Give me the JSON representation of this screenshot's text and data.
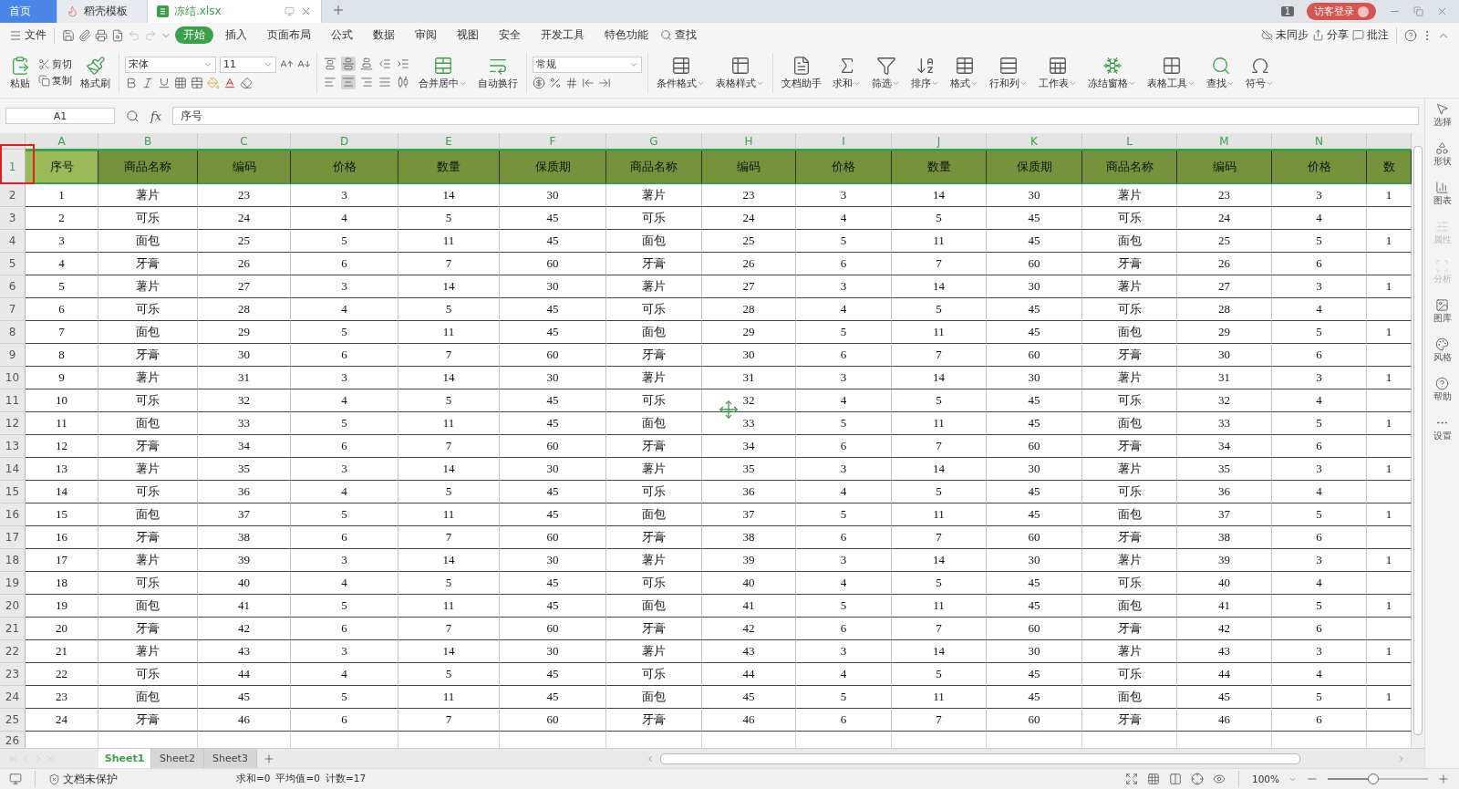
{
  "app_tabs": [
    {
      "label": "首页",
      "kind": "home",
      "selected": false
    },
    {
      "label": "稻壳模板",
      "kind": "template",
      "selected": false
    },
    {
      "label": "冻结.xlsx",
      "kind": "sheet",
      "selected": true
    }
  ],
  "top_right": {
    "badge": "1",
    "login": "访客登录"
  },
  "menu": {
    "file": "文件",
    "tabs": [
      {
        "label": "开始",
        "selected": true
      },
      {
        "label": "插入",
        "selected": false
      },
      {
        "label": "页面布局",
        "selected": false
      },
      {
        "label": "公式",
        "selected": false
      },
      {
        "label": "数据",
        "selected": false
      },
      {
        "label": "审阅",
        "selected": false
      },
      {
        "label": "视图",
        "selected": false
      },
      {
        "label": "安全",
        "selected": false
      },
      {
        "label": "开发工具",
        "selected": false
      },
      {
        "label": "特色功能",
        "selected": false
      }
    ],
    "search": "查找",
    "actions": [
      {
        "label": "未同步",
        "kind": "sync"
      },
      {
        "label": "分享",
        "kind": "share"
      },
      {
        "label": "批注",
        "kind": "comment"
      }
    ]
  },
  "ribbon": {
    "paste": "粘贴",
    "cut": "剪切",
    "copy": "复制",
    "format_painter": "格式刷",
    "font_name": "宋体",
    "font_size": "11",
    "align": [
      {
        "kind": "top",
        "selected": false
      },
      {
        "kind": "middle",
        "selected": true
      },
      {
        "kind": "bottom",
        "selected": false
      },
      {
        "kind": "outdent",
        "selected": false
      },
      {
        "kind": "indent",
        "selected": false
      },
      {
        "kind": "left",
        "selected": false
      },
      {
        "kind": "center",
        "selected": true
      },
      {
        "kind": "right",
        "selected": false
      },
      {
        "kind": "justify",
        "selected": false
      },
      {
        "kind": "distribute",
        "selected": false
      }
    ],
    "merge": "合并居中",
    "wrap": "自动换行",
    "number_format": "常规",
    "buttons": [
      {
        "label": "条件格式",
        "kind": "conditional"
      },
      {
        "label": "表格样式",
        "kind": "style"
      },
      {
        "label": "文档助手",
        "kind": "assistant"
      },
      {
        "label": "求和",
        "kind": "sum"
      },
      {
        "label": "筛选",
        "kind": "filter"
      },
      {
        "label": "排序",
        "kind": "sort"
      },
      {
        "label": "格式",
        "kind": "format"
      },
      {
        "label": "行和列",
        "kind": "rows"
      },
      {
        "label": "工作表",
        "kind": "sheet"
      },
      {
        "label": "冻结窗格",
        "kind": "freeze"
      },
      {
        "label": "表格工具",
        "kind": "tools"
      },
      {
        "label": "查找",
        "kind": "find"
      },
      {
        "label": "符号",
        "kind": "symbol"
      }
    ]
  },
  "formula_bar": {
    "cell": "A1",
    "fx": "fx",
    "value": "序号"
  },
  "columns": [
    "A",
    "B",
    "C",
    "D",
    "E",
    "F",
    "G",
    "H",
    "I",
    "J",
    "K",
    "L",
    "M",
    "N"
  ],
  "header_row": [
    {
      "text": "序号",
      "selected": true
    },
    {
      "text": "商品名称",
      "selected": false
    },
    {
      "text": "编码",
      "selected": false
    },
    {
      "text": "价格",
      "selected": false
    },
    {
      "text": "数量",
      "selected": false
    },
    {
      "text": "保质期",
      "selected": false
    },
    {
      "text": "商品名称",
      "selected": false
    },
    {
      "text": "编码",
      "selected": false
    },
    {
      "text": "价格",
      "selected": false
    },
    {
      "text": "数量",
      "selected": false
    },
    {
      "text": "保质期",
      "selected": false
    },
    {
      "text": "商品名称",
      "selected": false
    },
    {
      "text": "编码",
      "selected": false
    },
    {
      "text": "价格",
      "selected": false
    },
    {
      "text": "数",
      "selected": false
    }
  ],
  "rows": [
    [
      "1",
      "薯片",
      "23",
      "3",
      "14",
      "30",
      "薯片",
      "23",
      "3",
      "14",
      "30",
      "薯片",
      "23",
      "3",
      "1"
    ],
    [
      "2",
      "可乐",
      "24",
      "4",
      "5",
      "45",
      "可乐",
      "24",
      "4",
      "5",
      "45",
      "可乐",
      "24",
      "4"
    ],
    [
      "3",
      "面包",
      "25",
      "5",
      "11",
      "45",
      "面包",
      "25",
      "5",
      "11",
      "45",
      "面包",
      "25",
      "5",
      "1"
    ],
    [
      "4",
      "牙膏",
      "26",
      "6",
      "7",
      "60",
      "牙膏",
      "26",
      "6",
      "7",
      "60",
      "牙膏",
      "26",
      "6"
    ],
    [
      "5",
      "薯片",
      "27",
      "3",
      "14",
      "30",
      "薯片",
      "27",
      "3",
      "14",
      "30",
      "薯片",
      "27",
      "3",
      "1"
    ],
    [
      "6",
      "可乐",
      "28",
      "4",
      "5",
      "45",
      "可乐",
      "28",
      "4",
      "5",
      "45",
      "可乐",
      "28",
      "4"
    ],
    [
      "7",
      "面包",
      "29",
      "5",
      "11",
      "45",
      "面包",
      "29",
      "5",
      "11",
      "45",
      "面包",
      "29",
      "5",
      "1"
    ],
    [
      "8",
      "牙膏",
      "30",
      "6",
      "7",
      "60",
      "牙膏",
      "30",
      "6",
      "7",
      "60",
      "牙膏",
      "30",
      "6"
    ],
    [
      "9",
      "薯片",
      "31",
      "3",
      "14",
      "30",
      "薯片",
      "31",
      "3",
      "14",
      "30",
      "薯片",
      "31",
      "3",
      "1"
    ],
    [
      "10",
      "可乐",
      "32",
      "4",
      "5",
      "45",
      "可乐",
      "32",
      "4",
      "5",
      "45",
      "可乐",
      "32",
      "4"
    ],
    [
      "11",
      "面包",
      "33",
      "5",
      "11",
      "45",
      "面包",
      "33",
      "5",
      "11",
      "45",
      "面包",
      "33",
      "5",
      "1"
    ],
    [
      "12",
      "牙膏",
      "34",
      "6",
      "7",
      "60",
      "牙膏",
      "34",
      "6",
      "7",
      "60",
      "牙膏",
      "34",
      "6"
    ],
    [
      "13",
      "薯片",
      "35",
      "3",
      "14",
      "30",
      "薯片",
      "35",
      "3",
      "14",
      "30",
      "薯片",
      "35",
      "3",
      "1"
    ],
    [
      "14",
      "可乐",
      "36",
      "4",
      "5",
      "45",
      "可乐",
      "36",
      "4",
      "5",
      "45",
      "可乐",
      "36",
      "4"
    ],
    [
      "15",
      "面包",
      "37",
      "5",
      "11",
      "45",
      "面包",
      "37",
      "5",
      "11",
      "45",
      "面包",
      "37",
      "5",
      "1"
    ],
    [
      "16",
      "牙膏",
      "38",
      "6",
      "7",
      "60",
      "牙膏",
      "38",
      "6",
      "7",
      "60",
      "牙膏",
      "38",
      "6"
    ],
    [
      "17",
      "薯片",
      "39",
      "3",
      "14",
      "30",
      "薯片",
      "39",
      "3",
      "14",
      "30",
      "薯片",
      "39",
      "3",
      "1"
    ],
    [
      "18",
      "可乐",
      "40",
      "4",
      "5",
      "45",
      "可乐",
      "40",
      "4",
      "5",
      "45",
      "可乐",
      "40",
      "4"
    ],
    [
      "19",
      "面包",
      "41",
      "5",
      "11",
      "45",
      "面包",
      "41",
      "5",
      "11",
      "45",
      "面包",
      "41",
      "5",
      "1"
    ],
    [
      "20",
      "牙膏",
      "42",
      "6",
      "7",
      "60",
      "牙膏",
      "42",
      "6",
      "7",
      "60",
      "牙膏",
      "42",
      "6"
    ],
    [
      "21",
      "薯片",
      "43",
      "3",
      "14",
      "30",
      "薯片",
      "43",
      "3",
      "14",
      "30",
      "薯片",
      "43",
      "3",
      "1"
    ],
    [
      "22",
      "可乐",
      "44",
      "4",
      "5",
      "45",
      "可乐",
      "44",
      "4",
      "5",
      "45",
      "可乐",
      "44",
      "4"
    ],
    [
      "23",
      "面包",
      "45",
      "5",
      "11",
      "45",
      "面包",
      "45",
      "5",
      "11",
      "45",
      "面包",
      "45",
      "5",
      "1"
    ],
    [
      "24",
      "牙膏",
      "46",
      "6",
      "7",
      "60",
      "牙膏",
      "46",
      "6",
      "7",
      "60",
      "牙膏",
      "46",
      "6"
    ]
  ],
  "row_numbers": [
    "1",
    "2",
    "3",
    "4",
    "5",
    "6",
    "7",
    "8",
    "9",
    "10",
    "11",
    "12",
    "13",
    "14",
    "15",
    "16",
    "17",
    "18",
    "19",
    "20",
    "21",
    "22",
    "23",
    "24",
    "25",
    "26"
  ],
  "sheets": [
    {
      "label": "Sheet1",
      "selected": true
    },
    {
      "label": "Sheet2",
      "selected": false
    },
    {
      "label": "Sheet3",
      "selected": false
    }
  ],
  "sidebar": [
    {
      "label": "选择",
      "kind": "select",
      "disabled": false
    },
    {
      "label": "形状",
      "kind": "shape",
      "disabled": false
    },
    {
      "label": "图表",
      "kind": "chart",
      "disabled": false
    },
    {
      "label": "属性",
      "kind": "props",
      "disabled": true
    },
    {
      "label": "分析",
      "kind": "analyze",
      "disabled": true
    },
    {
      "label": "图库",
      "kind": "gallery",
      "disabled": false
    },
    {
      "label": "风格",
      "kind": "style",
      "disabled": false
    },
    {
      "label": "帮助",
      "kind": "help",
      "disabled": false
    },
    {
      "label": "设置",
      "kind": "settings",
      "disabled": false
    }
  ],
  "status_bar": {
    "protection": "文档未保护",
    "stats": [
      "求和=0",
      "平均值=0",
      "计数=17"
    ],
    "zoom": "100%",
    "zoom_level": {
      "level": 0.45
    }
  }
}
